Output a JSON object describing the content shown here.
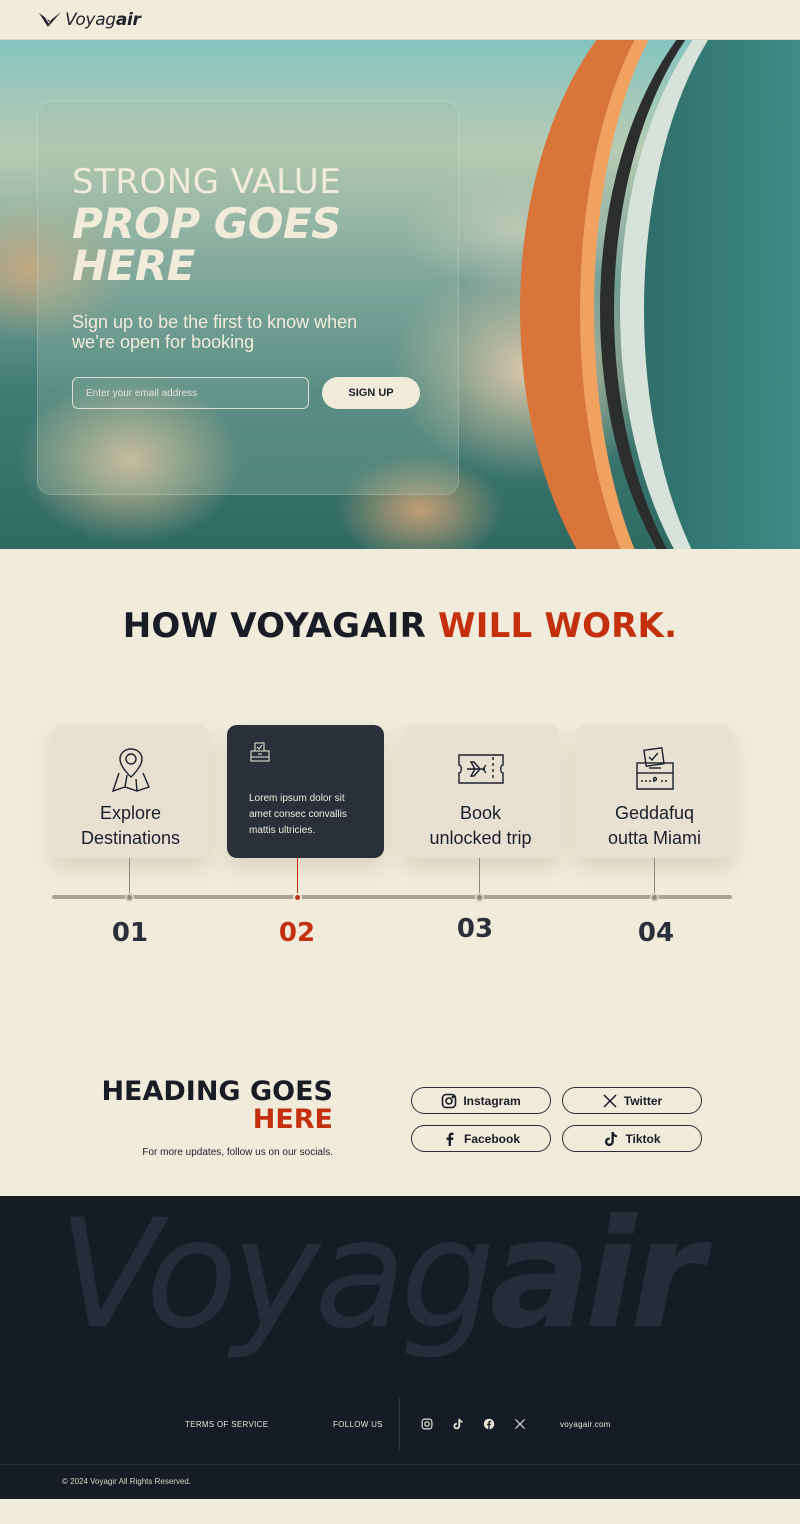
{
  "nav": {
    "logo_regular": "Voyag",
    "logo_bold": "air"
  },
  "hero": {
    "headline_line1": "STRONG VALUE",
    "headline_line2": "PROP GOES",
    "headline_line3": "HERE",
    "subheadline": "Sign up to be the first to know when we’re open for booking",
    "email_placeholder": "Enter your email address",
    "signup_label": "SIGN UP"
  },
  "how": {
    "title_main": "HOW VOYAGAIR ",
    "title_accent": "WILL WORK.",
    "steps": [
      {
        "label_line1": "Explore",
        "label_line2": "Destinations",
        "number": "01",
        "icon": "map-pin-icon"
      },
      {
        "text": "Lorem ipsum dolor sit amet consec convallis mattis ultricies.",
        "number": "02",
        "icon": "ballot-icon"
      },
      {
        "label_line1": "Book",
        "label_line2": "unlocked trip",
        "number": "03",
        "icon": "plane-ticket-icon"
      },
      {
        "label_line1": "Geddafuq",
        "label_line2": "outta Miami",
        "number": "04",
        "icon": "ballot-box-icon"
      }
    ]
  },
  "social": {
    "heading_main": "HEADING GOES",
    "heading_accent": "HERE",
    "subtext": "For more updates, follow us on our socials.",
    "buttons": [
      {
        "label": "Instagram",
        "icon": "instagram-icon"
      },
      {
        "label": "Twitter",
        "icon": "x-twitter-icon"
      },
      {
        "label": "Facebook",
        "icon": "facebook-icon"
      },
      {
        "label": "Tiktok",
        "icon": "tiktok-icon"
      }
    ]
  },
  "footer": {
    "watermark_regular": "Voyag",
    "watermark_bold": "air",
    "terms": "TERMS OF SERVICE",
    "follow": "FOLLOW US",
    "site": "voyagair.com",
    "copyright": "© 2024 Voyagir All Rights Reserved."
  },
  "colors": {
    "accent": "#c4300d",
    "cream": "#f1ebdc",
    "dark": "#161c25",
    "card_dark": "#2a3039"
  }
}
